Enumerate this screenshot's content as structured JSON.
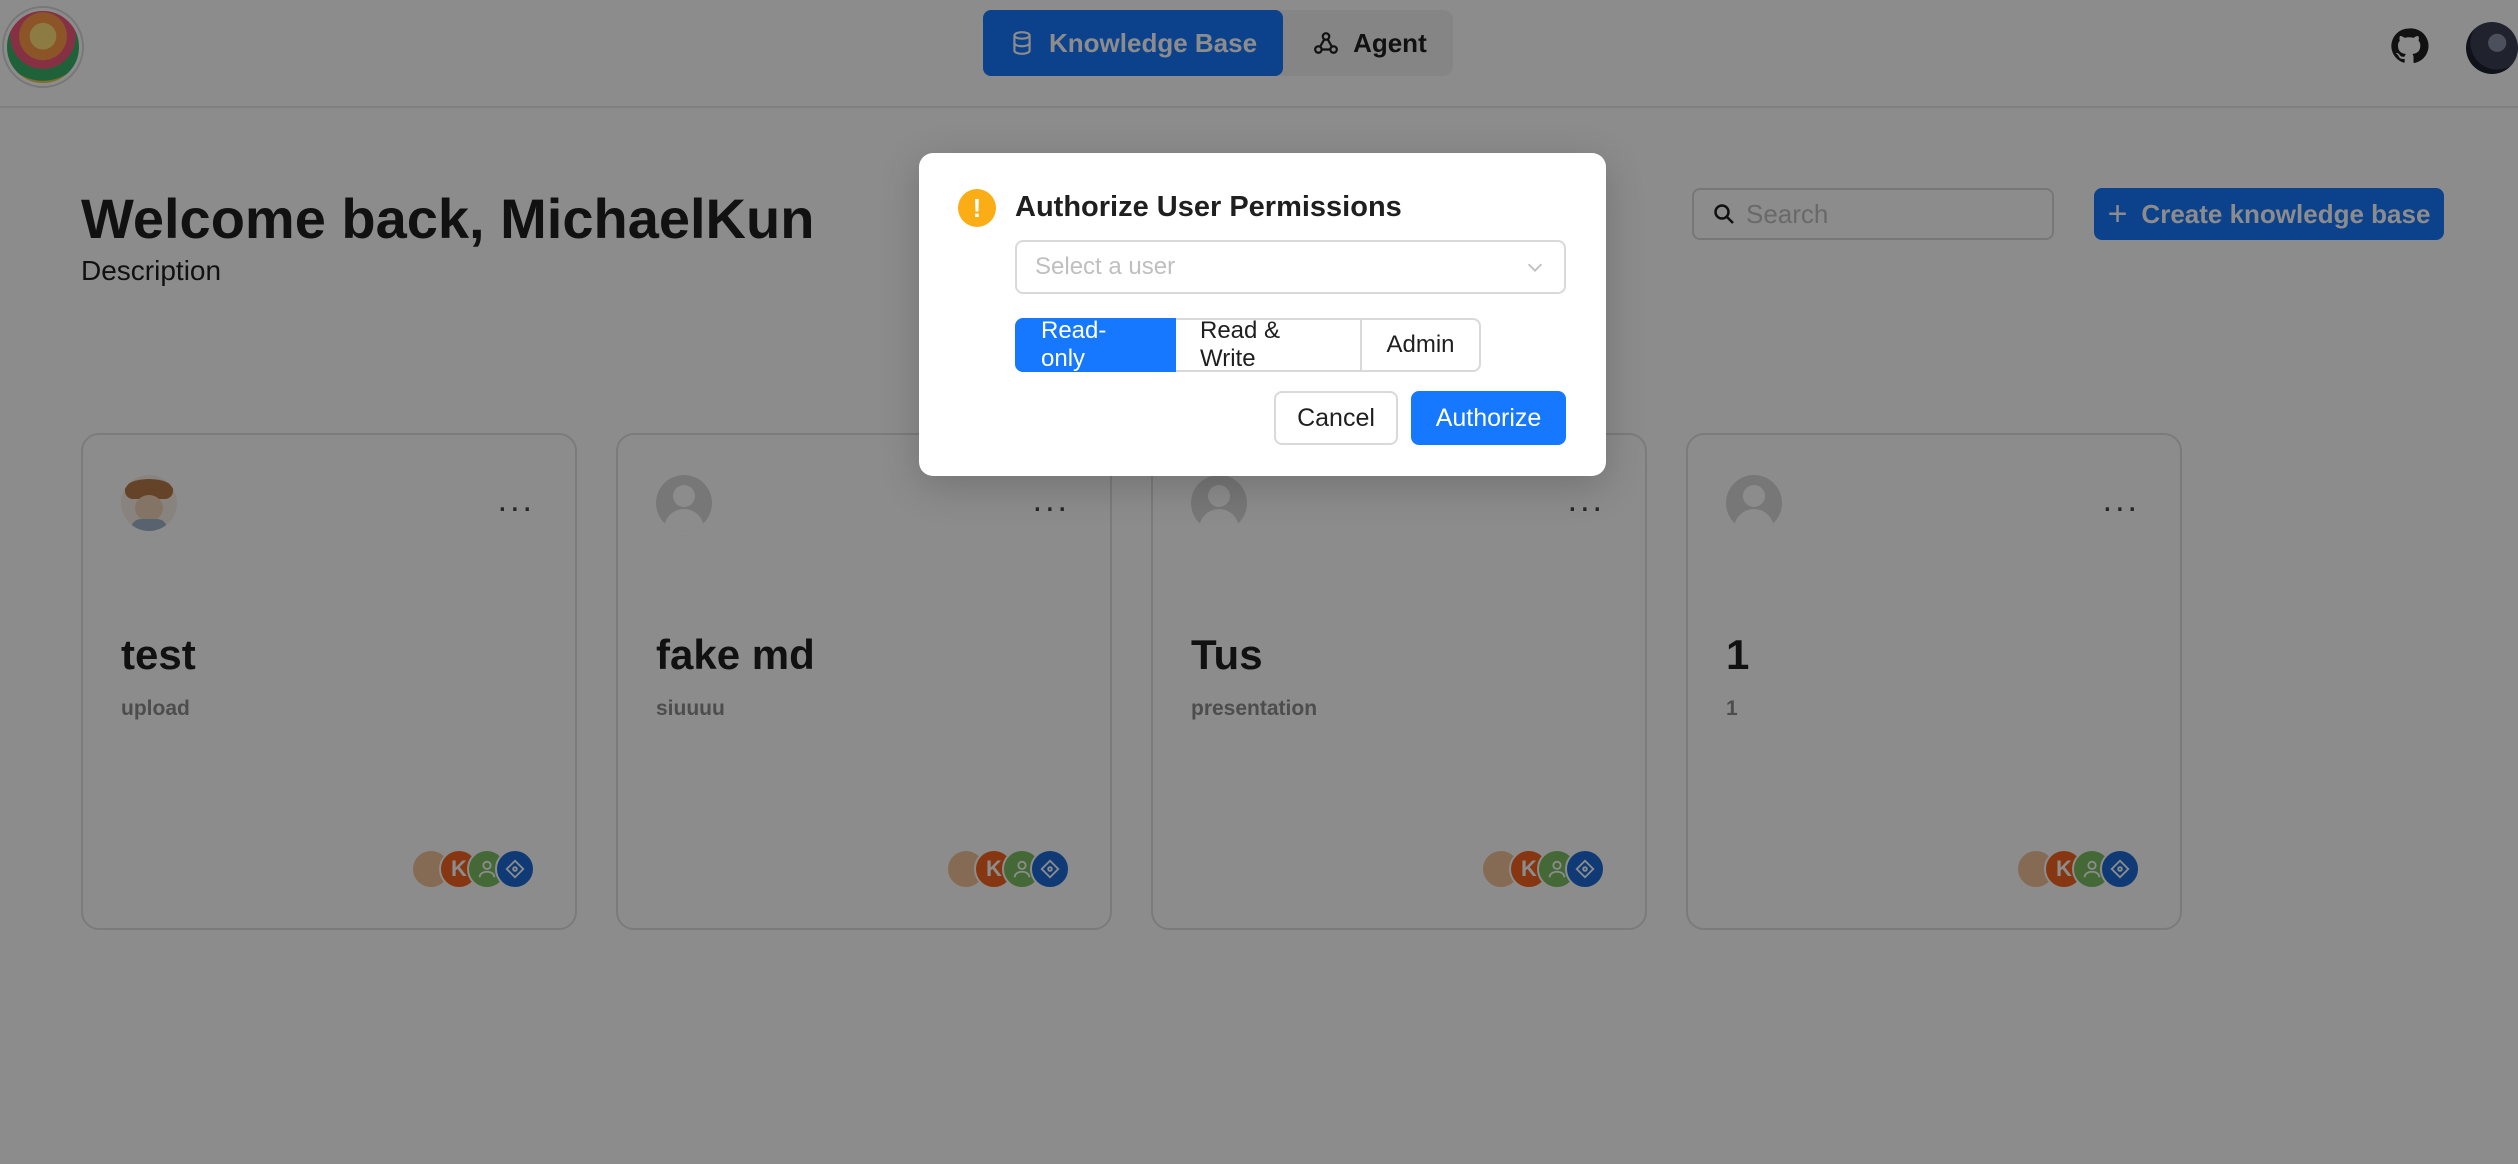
{
  "nav": {
    "knowledge_base_label": "Knowledge Base",
    "agent_label": "Agent",
    "active": "Knowledge Base"
  },
  "page": {
    "welcome_title": "Welcome back, MichaelKun",
    "description": "Description"
  },
  "search": {
    "placeholder": "Search"
  },
  "create_button_label": "Create knowledge base",
  "cards": [
    {
      "title": "test",
      "subtitle": "upload",
      "more": "...",
      "avatar": "custom-avatar",
      "member_k": "K"
    },
    {
      "title": "fake md",
      "subtitle": "siuuuu",
      "more": "...",
      "avatar": "default-avatar",
      "member_k": "K"
    },
    {
      "title": "Tus",
      "subtitle": "presentation",
      "more": "...",
      "avatar": "default-avatar",
      "member_k": "K"
    },
    {
      "title": "1",
      "subtitle": "1",
      "more": "...",
      "avatar": "default-avatar",
      "member_k": "K"
    }
  ],
  "modal": {
    "title": "Authorize User Permissions",
    "icon": "!",
    "select_placeholder": "Select a user",
    "permissions": [
      "Read-only",
      "Read & Write",
      "Admin"
    ],
    "selected_permission": "Read-only",
    "cancel_label": "Cancel",
    "authorize_label": "Authorize"
  },
  "colors": {
    "primary": "#1677ff",
    "warning": "#faad14",
    "overlay": "rgba(0,0,0,0.45)"
  }
}
